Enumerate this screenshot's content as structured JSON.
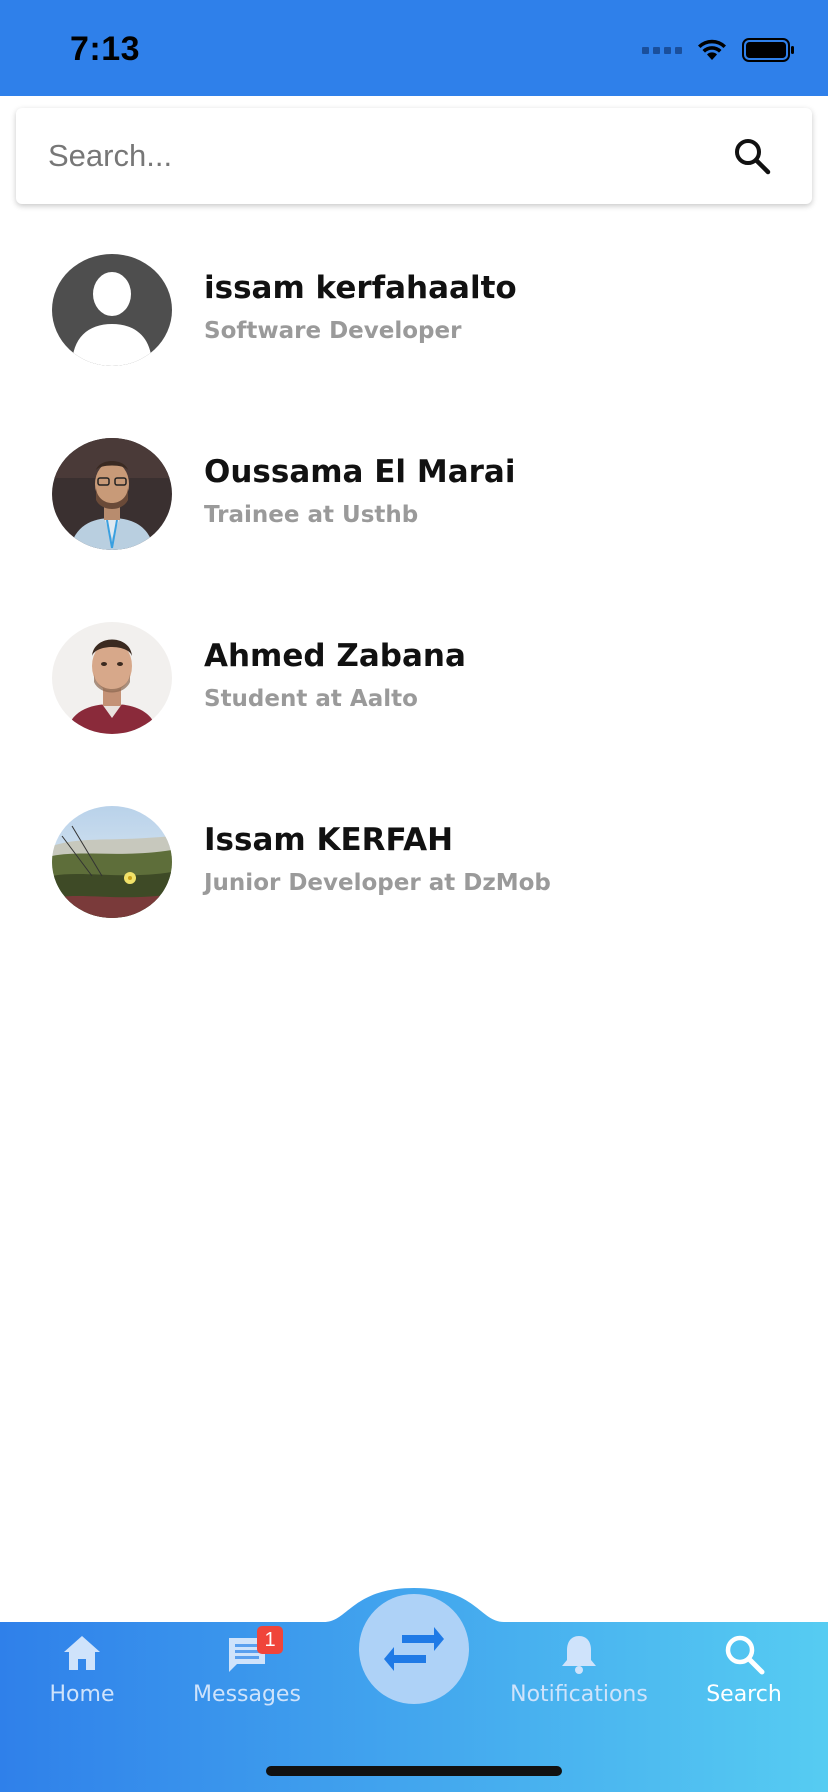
{
  "status_bar": {
    "time": "7:13"
  },
  "search": {
    "placeholder": "Search...",
    "value": ""
  },
  "contacts": [
    {
      "name": "issam kerfahaalto",
      "title": "Software Developer",
      "avatar": "default-avatar"
    },
    {
      "name": "Oussama El Marai",
      "title": "Trainee at Usthb",
      "avatar": "photo-man-glasses"
    },
    {
      "name": "Ahmed Zabana",
      "title": "Student at Aalto",
      "avatar": "photo-man-portrait"
    },
    {
      "name": "Issam KERFAH",
      "title": "Junior Developer at DzMob",
      "avatar": "photo-nature-flower"
    }
  ],
  "bottom_nav": {
    "items": [
      {
        "label": "Home",
        "icon": "home-icon"
      },
      {
        "label": "Messages",
        "icon": "message-icon",
        "badge": "1"
      },
      {
        "label": "Notifications",
        "icon": "bell-icon"
      },
      {
        "label": "Search",
        "icon": "search-icon",
        "active": true
      }
    ],
    "center_icon": "swap-arrows-icon"
  },
  "colors": {
    "accent": "#2F80EA",
    "nav_gradient_start": "#2F80EA",
    "nav_gradient_end": "#56CCF2",
    "badge": "#F0453A",
    "subtitle": "#9A9A9A"
  }
}
